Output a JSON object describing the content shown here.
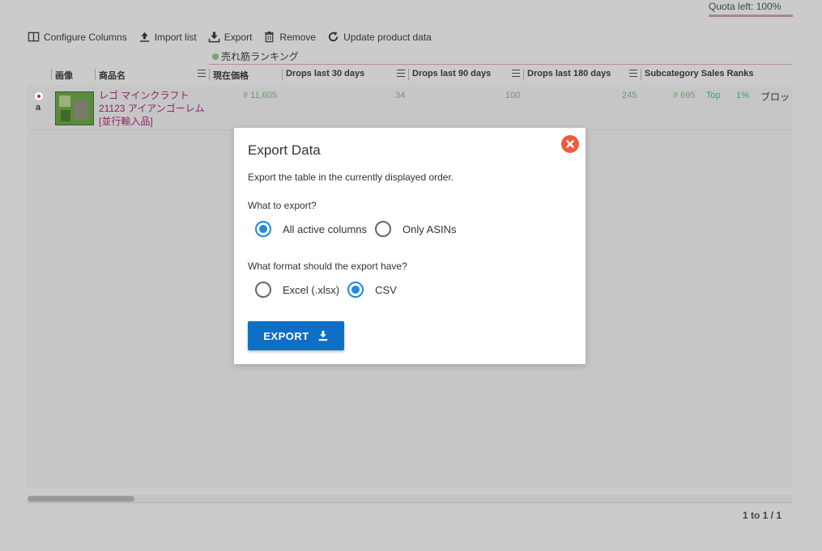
{
  "quota": "Quota left: 100%",
  "toolbar": {
    "configure": "Configure Columns",
    "import": "Import list",
    "export": "Export",
    "remove": "Remove",
    "update": "Update product data"
  },
  "group_header": "売れ筋ランキング",
  "columns": {
    "image": "画像",
    "name": "商品名",
    "price": "現在価格",
    "drops30": "Drops last 30 days",
    "drops90": "Drops last 90 days",
    "drops180": "Drops last 180 days",
    "subcat": "Subcategory Sales Ranks"
  },
  "row": {
    "amazon_mark": "a",
    "name1": "レゴ マインクラフト",
    "name2": "21123 アイアンゴーレム",
    "name3": "[並行輸入品]",
    "price": "# 11,605",
    "drops30": "34",
    "drops90": "100",
    "drops180": "245",
    "subcat_rank": "# 695",
    "subcat_top": "Top",
    "subcat_pct": "1%",
    "subcat_name": "ブロッ"
  },
  "pagination": "1 to 1 / 1",
  "modal": {
    "title": "Export Data",
    "description": "Export the table in the currently displayed order.",
    "q1": "What to export?",
    "opt_all": "All active columns",
    "opt_asins": "Only ASINs",
    "q2": "What format should the export have?",
    "opt_excel": "Excel (.xlsx)",
    "opt_csv": "CSV",
    "button": "EXPORT",
    "selected_content": "All active columns",
    "selected_format": "CSV"
  },
  "colors": {
    "accent": "#1e88e5",
    "button": "#0f6fc6",
    "close": "#f05a3a",
    "product_link": "#8b2467"
  }
}
